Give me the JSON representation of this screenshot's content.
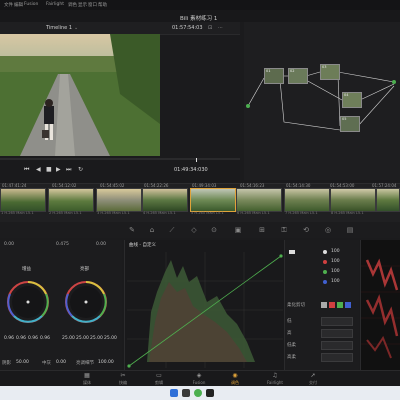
{
  "menu": {
    "items": [
      "文件",
      "编辑",
      "Fusion",
      "Fairlight",
      "调色",
      "显示",
      "窗口",
      "帮助"
    ]
  },
  "window_title": "Bili 素材练习 1",
  "viewer": {
    "timeline_name": "Timeline 1",
    "source_timecode": "01:57:54:03",
    "record_timecode": "01:49:34:030"
  },
  "thumbnails": [
    {
      "tc": "01:47:41:24",
      "label": "1 H.265 Main L5.1"
    },
    {
      "tc": "01:54:12:02",
      "label": "2 H.265 Main L5.1"
    },
    {
      "tc": "01:54:45:02",
      "label": "3 H.265 Main L5.1"
    },
    {
      "tc": "01:54:22:26",
      "label": "4 H.265 Main L5.1"
    },
    {
      "tc": "01:49:34:03",
      "label": "5 H.265 Main L5.1"
    },
    {
      "tc": "01:54:16:23",
      "label": "6 H.265 Main L5.1"
    },
    {
      "tc": "01:54:14:30",
      "label": "7 H.265 Main L5.1"
    },
    {
      "tc": "01:54:53:00",
      "label": "8 H.265 Main L5.1"
    },
    {
      "tc": "01:57:24:04",
      "label": "9 H.265 Main L5.1"
    }
  ],
  "nodes": [
    "01",
    "02",
    "03",
    "04",
    "05"
  ],
  "wheels": {
    "label_a": "增益",
    "label_b": "亮部",
    "header_left": "0.00",
    "header_mid": "0.475",
    "header_right": "0.00",
    "left_values": [
      "0.96",
      "0.96",
      "0.96",
      "0.96"
    ],
    "right_values": [
      "25.00",
      "25.00",
      "25.00",
      "25.00"
    ],
    "bottom_left_label": "阴影",
    "bottom_left_value": "50.00",
    "bottom_mid_label": "中灰",
    "bottom_mid_value": "0.00",
    "bottom_right_label": "亮调细节",
    "bottom_right_value": "100.00"
  },
  "curves": {
    "title": "曲线 - 自定义"
  },
  "controls": {
    "channel_values": [
      "100",
      "100",
      "100",
      "100"
    ],
    "soft_clip_label": "柔化剪切",
    "rows": [
      "低",
      "高",
      "低柔",
      "高柔"
    ]
  },
  "pages": [
    {
      "icon": "media-icon",
      "label": "媒体"
    },
    {
      "icon": "cut-icon",
      "label": "快编"
    },
    {
      "icon": "edit-icon",
      "label": "剪辑"
    },
    {
      "icon": "fusion-icon",
      "label": "Fusion"
    },
    {
      "icon": "color-icon",
      "label": "调色"
    },
    {
      "icon": "fairlight-icon",
      "label": "Fairlight"
    },
    {
      "icon": "deliver-icon",
      "label": "交付"
    }
  ],
  "colors": {
    "accent": "#e0a33a",
    "node_green": "#4caf50",
    "curve_red": "#d04040",
    "curve_green": "#4fb04f"
  }
}
